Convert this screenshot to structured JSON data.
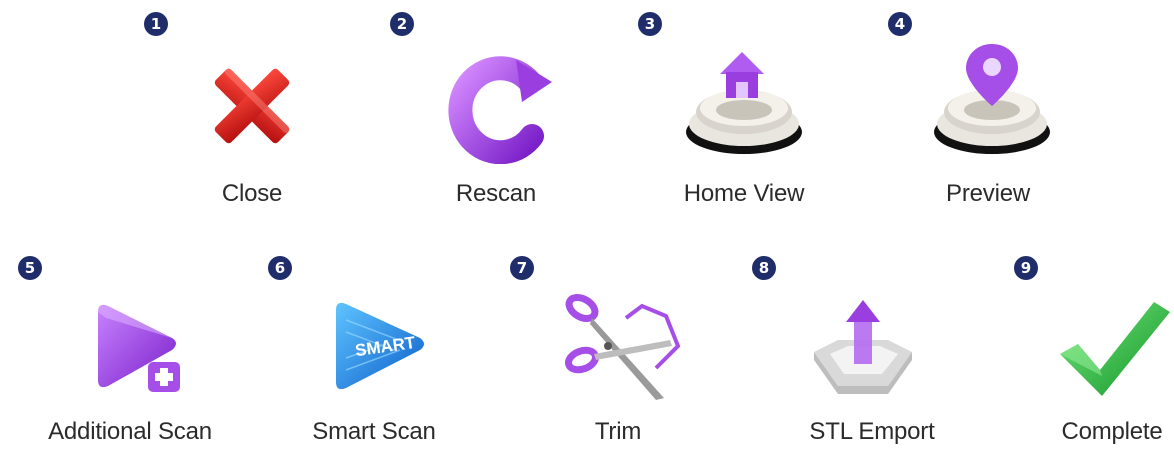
{
  "colors": {
    "badge": "#1f2d6b",
    "label": "#2b2b2b",
    "close_red": "#e01f1f",
    "purple": "#a64ee8",
    "smart_blue": "#1f8fe8",
    "check_green": "#2dbf4a"
  },
  "items": [
    {
      "num": "1",
      "label": "Close",
      "icon": "close-x-icon"
    },
    {
      "num": "2",
      "label": "Rescan",
      "icon": "rescan-arrow-icon"
    },
    {
      "num": "3",
      "label": "Home View",
      "icon": "home-dental-model-icon"
    },
    {
      "num": "4",
      "label": "Preview",
      "icon": "location-pin-dental-model-icon"
    },
    {
      "num": "5",
      "label": "Additional Scan",
      "icon": "additional-scan-play-plus-icon"
    },
    {
      "num": "6",
      "label": "Smart Scan",
      "icon": "smart-scan-icon",
      "icon_text": "SMART"
    },
    {
      "num": "7",
      "label": "Trim",
      "icon": "scissors-trim-icon"
    },
    {
      "num": "8",
      "label": "STL Emport",
      "icon": "stl-export-tray-icon"
    },
    {
      "num": "9",
      "label": "Complete",
      "icon": "checkmark-icon"
    }
  ]
}
